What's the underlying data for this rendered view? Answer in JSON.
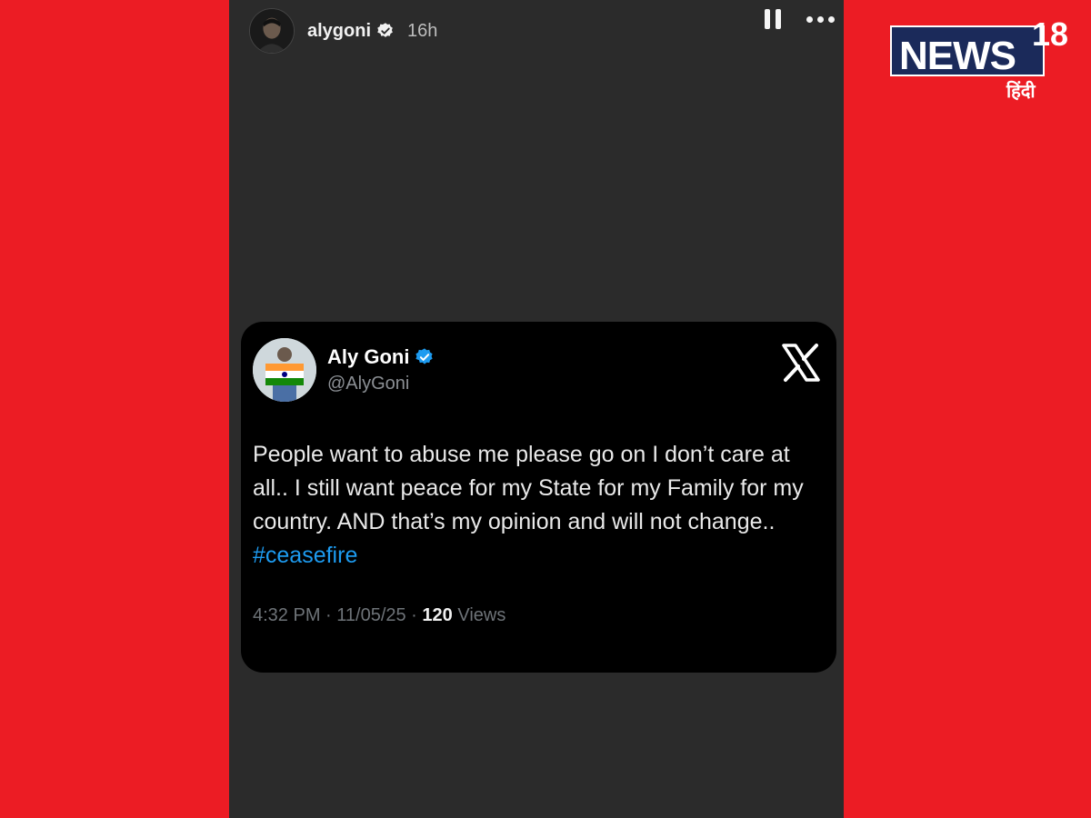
{
  "story": {
    "username": "alygoni",
    "time": "16h"
  },
  "tweet": {
    "name": "Aly Goni",
    "handle": "@AlyGoni",
    "text": "People want to abuse me please go on I don’t care at all.. I still want peace for my State for my Family for my country. AND that’s my opinion and will not change..",
    "hashtag": "#ceasefire",
    "meta_prefix": "4:32 PM · 11/05/25 · ",
    "views_count": "120",
    "views_label": " Views"
  },
  "logo": {
    "word": "NEWS",
    "number": "18",
    "subtitle": "हिंदी"
  },
  "colors": {
    "background_red": "#ec1c24",
    "story_bg": "#2b2b2b",
    "hashtag_blue": "#1d9bf0",
    "logo_navy": "#1b2a5a"
  },
  "icons": {
    "story_verified": "verified-badge-icon",
    "tweet_verified": "blue-verified-icon",
    "pause": "pause-icon",
    "more": "more-options-icon",
    "platform": "x-logo-icon"
  }
}
